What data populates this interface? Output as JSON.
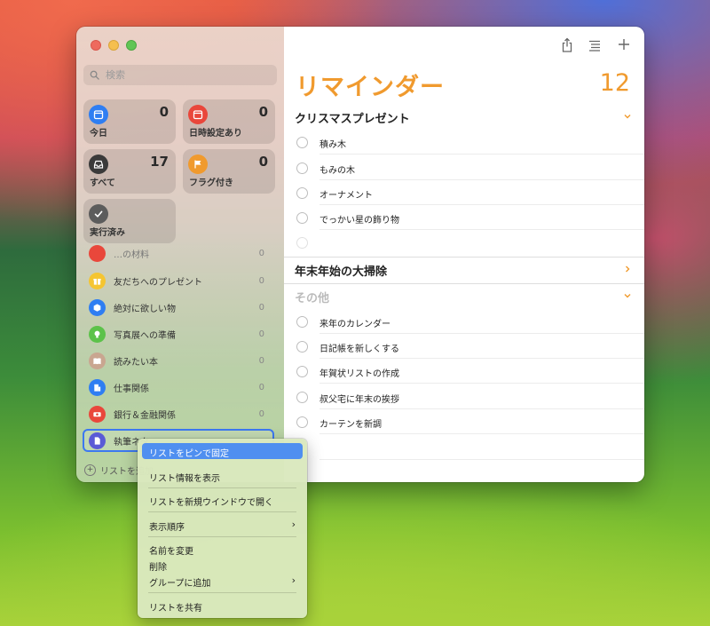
{
  "search": {
    "placeholder": "検索"
  },
  "smart_lists": [
    {
      "label": "今日",
      "count": "0",
      "icon": "calendar-today-icon",
      "color": "#2f7ef2"
    },
    {
      "label": "日時設定あり",
      "count": "0",
      "icon": "calendar-icon",
      "color": "#e9473b"
    },
    {
      "label": "すべて",
      "count": "17",
      "icon": "tray-icon",
      "color": "#3a3a3a"
    },
    {
      "label": "フラグ付き",
      "count": "0",
      "icon": "flag-icon",
      "color": "#f09a2e"
    },
    {
      "label": "実行済み",
      "count": "",
      "icon": "checkmark-icon",
      "color": "#5c5c5c"
    }
  ],
  "lists": [
    {
      "name": "…の材料",
      "count": "0",
      "icon": "list-icon",
      "color": "#e9473b"
    },
    {
      "name": "友だちへのプレゼント",
      "count": "0",
      "icon": "gift-icon",
      "color": "#f5c531"
    },
    {
      "name": "絶対に欲しい物",
      "count": "0",
      "icon": "cube-icon",
      "color": "#2f7ef2"
    },
    {
      "name": "写真展への準備",
      "count": "0",
      "icon": "lightbulb-icon",
      "color": "#5cc24a"
    },
    {
      "name": "読みたい本",
      "count": "0",
      "icon": "book-icon",
      "color": "#c9a690"
    },
    {
      "name": "仕事関係",
      "count": "0",
      "icon": "building-icon",
      "color": "#2f7ef2"
    },
    {
      "name": "銀行＆金融関係",
      "count": "0",
      "icon": "money-icon",
      "color": "#e9473b"
    },
    {
      "name": "執筆ネタ",
      "count": "",
      "icon": "doc-icon",
      "color": "#5b5bd6"
    }
  ],
  "add_list_label": "リストを追加",
  "main": {
    "title": "リマインダー",
    "count": "12",
    "sections": [
      {
        "title": "クリスマスプレゼント",
        "tasks": [
          "積み木",
          "もみの木",
          "オーナメント",
          "でっかい星の飾り物",
          ""
        ]
      },
      {
        "title": "年末年始の大掃除",
        "tasks": []
      },
      {
        "title": "その他",
        "tasks": [
          "来年のカレンダー",
          "日記帳を新しくする",
          "年賀状リストの作成",
          "叔父宅に年末の挨拶",
          "カーテンを新調",
          ""
        ]
      }
    ]
  },
  "context_menu": [
    "リストをピンで固定",
    "リスト情報を表示",
    "リストを新規ウインドウで開く",
    "表示順序",
    "名前を変更",
    "削除",
    "グループに追加",
    "リストを共有"
  ],
  "colors": {
    "accent": "#f09a2e",
    "selection": "#3c78f0",
    "menu_highlight": "#4f8ff0"
  }
}
